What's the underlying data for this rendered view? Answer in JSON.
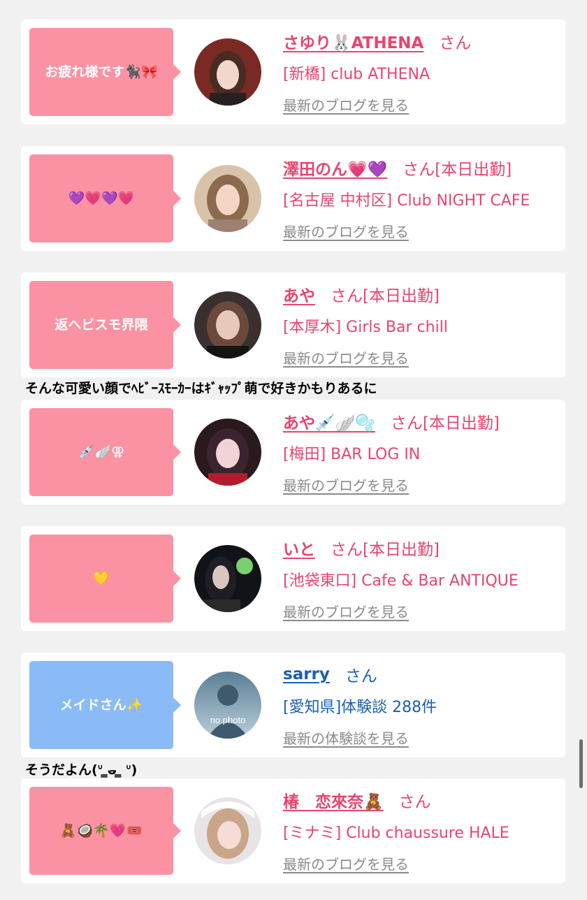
{
  "entries": [
    {
      "bubble_text": "お疲れ様です🐈‍⬛🎀",
      "bubble_color": "#fb92a3",
      "name": "さゆり🐰ATHENA",
      "honorific": "さん",
      "shop": "[新橋] club ATHENA",
      "link": "最新のブログを見る"
    },
    {
      "bubble_text": "💜💗💜💗",
      "bubble_color": "#fb92a3",
      "name": "澤田のん💗💜",
      "honorific": "さん[本日出勤]",
      "shop": "[名古屋 中村区] Club NIGHT CAFE",
      "link": "最新のブログを見る"
    },
    {
      "bubble_text": "返へビスモ界隈",
      "bubble_color": "#fb92a3",
      "name": "あや",
      "honorific": "さん[本日出勤]",
      "shop": "[本厚木] Girls Bar chill",
      "link": "最新のブログを見る"
    },
    {
      "bubble_text": "💉🪽⚢",
      "bubble_color": "#fb92a3",
      "name": "あや💉🪽🫧",
      "honorific": "さん[本日出勤]",
      "shop": "[梅田] BAR LOG IN",
      "link": "最新のブログを見る"
    },
    {
      "bubble_text": "💛",
      "bubble_color": "#fb92a3",
      "name": "いと",
      "honorific": "さん[本日出勤]",
      "shop": "[池袋東口] Cafe & Bar ANTIQUE",
      "link": "最新のブログを見る"
    },
    {
      "bubble_text": "メイドさん✨",
      "bubble_color": "#8bbbf6",
      "name": "sarry",
      "honorific": "さん",
      "shop": "[愛知県]体験談 288件",
      "link": "最新の体験談を見る",
      "avatar_text": "no photo"
    },
    {
      "bubble_text": "🧸🥥🌴💗🎟️",
      "bubble_color": "#fb92a3",
      "name": "椿　恋來奈🧸",
      "honorific": "さん",
      "shop": "[ミナミ] Club chaussure HALE",
      "link": "最新のブログを見る"
    }
  ],
  "captions": [
    "そんな可愛い顔でﾍﾋﾞｰｽﾓｰｶｰはｷﾞｬｯﾌﾟ萌で好きかもりあるに",
    "そうだよん(ᐡ ̳ᴗ̵ ̳ ᐡ)"
  ],
  "colors": {
    "accent_pink": "#e8446d",
    "accent_blue": "#1a5fb4",
    "bubble_pink": "#fb92a3",
    "bubble_blue": "#8bbbf6",
    "link_gray": "#8a8a8a"
  }
}
